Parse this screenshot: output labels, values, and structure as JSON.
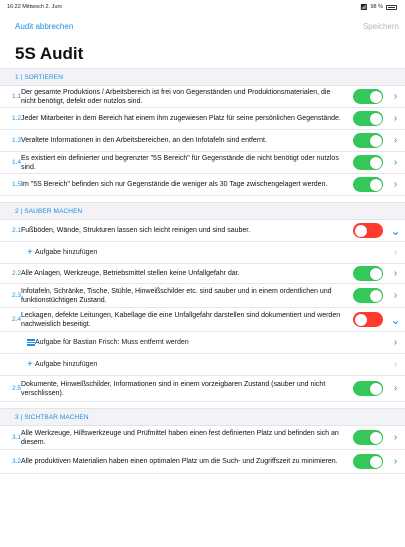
{
  "status_bar": {
    "time": "16:22",
    "date": "Mittwoch 2. Juni",
    "battery": "98 %"
  },
  "nav": {
    "cancel": "Audit abbrechen",
    "save": "Speichern"
  },
  "title": "5S Audit",
  "colors": {
    "accent": "#1a8fe3",
    "toggle_on": "#34c759",
    "toggle_off": "#ff3b30"
  },
  "sections": [
    {
      "header": "1 | SORTIEREN",
      "items": [
        {
          "num": "1.1",
          "text": "Der gesamte Produktions / Arbeitsbereich ist frei von Gegenständen und Produktionsmaterialen, die nicht benötigt, defekt oder nutzlos sind.",
          "state": "on"
        },
        {
          "num": "1.2",
          "text": "Jeder Mitarbeiter in dem Bereich hat einem ihm zugewiesen Platz für seine persönlichen Gegenstände.",
          "state": "on"
        },
        {
          "num": "1.3",
          "text": "Veraltete Informationen in den Arbeitsbereichen, an den Infotafeln sind entfernt.",
          "state": "on"
        },
        {
          "num": "1.4",
          "text": "Es existiert ein definierter und begrenzter \"5S Bereich\" für Gegenstände die nicht benötigt oder nutzlos sind.",
          "state": "on"
        },
        {
          "num": "1.5",
          "text": "Im \"5S Bereich\" befinden sich nur Gegenstände die weniger als 30 Tage zwischengelagert werden.",
          "state": "on"
        }
      ]
    },
    {
      "header": "2 | SAUBER MACHEN",
      "items": [
        {
          "num": "2.1",
          "text": "Fußböden, Wände, Strukturen lassen sich leicht reinigen und sind sauber.",
          "state": "off"
        },
        {
          "add": "Aufgabe hinzufügen"
        },
        {
          "num": "2.2",
          "text": "Alle Anlagen, Werkzeuge, Betriebsmittel stellen keine Unfallgefahr dar.",
          "state": "on"
        },
        {
          "num": "2.3",
          "text": "Infotafeln, Schränke, Tische, Stühle, Hinweißschilder etc. sind sauber und in einem ordentlichen und funktionstüchtigen Zustand.",
          "state": "on"
        },
        {
          "num": "2.4",
          "text": "Leckagen, defekte Leitungen, Kabellage die eine Unfallgefahr darstellen sind dokumentiert und werden nachweislich beseitigt.",
          "state": "off"
        },
        {
          "task": "Aufgabe für Bastian Frisch: Muss entfernt werden"
        },
        {
          "add": "Aufgabe hinzufügen"
        },
        {
          "num": "2.5",
          "text": "Dokumente, Hinweißschilder, Informationen sind in einem vorzeigbaren Zustand (sauber und nicht verschlissen).",
          "state": "on"
        }
      ]
    },
    {
      "header": "3 | SICHTBAR MACHEN",
      "items": [
        {
          "num": "3.1",
          "text": "Alle Werkzeuge, Hilfswerkzeuge und Prüfmittel haben einen fest definierten Platz und befinden sich an diesem.",
          "state": "on"
        },
        {
          "num": "3.2",
          "text": "Alle produktiven Materialien haben einen optimalen Platz um die Such- und Zugriffszeit zu minimieren.",
          "state": "on"
        }
      ]
    }
  ]
}
